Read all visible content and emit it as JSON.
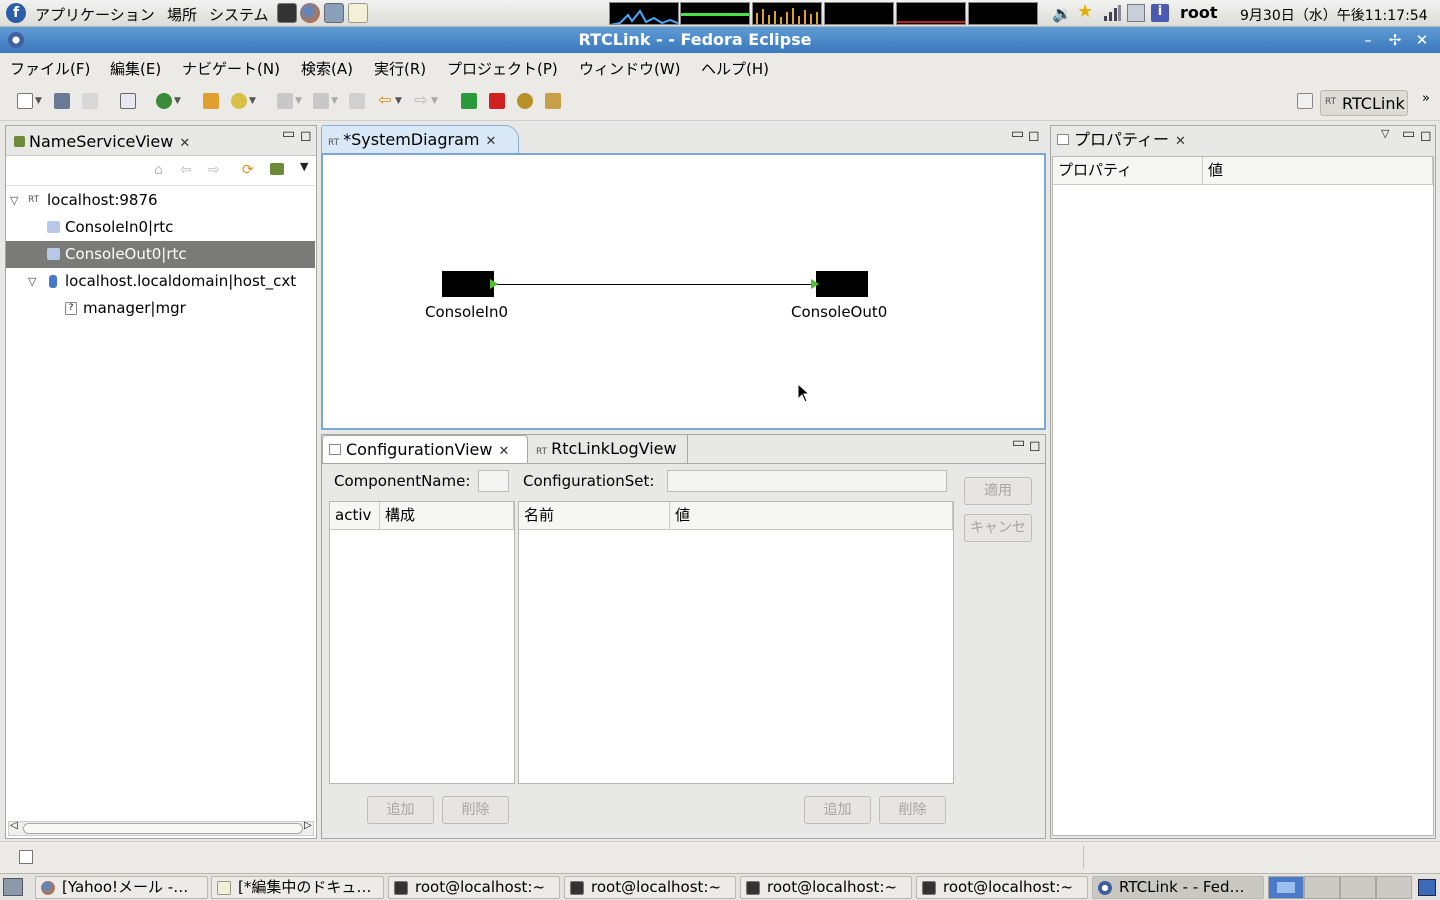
{
  "top_panel": {
    "menus": [
      "アプリケーション",
      "場所",
      "システム"
    ],
    "user": "root",
    "clock": "9月30日（水）午後11:17:54"
  },
  "window": {
    "title": "RTCLink -  - Fedora Eclipse"
  },
  "menubar": [
    "ファイル(F)",
    "編集(E)",
    "ナビゲート(N)",
    "検索(A)",
    "実行(R)",
    "プロジェクト(P)",
    "ウィンドウ(W)",
    "ヘルプ(H)"
  ],
  "perspective": {
    "label": "RTCLink"
  },
  "name_service_view": {
    "tab_label": "NameServiceView",
    "tree": [
      {
        "label": "localhost:9876",
        "expanded": true
      },
      {
        "label": "ConsoleIn0|rtc"
      },
      {
        "label": "ConsoleOut0|rtc",
        "selected": true
      },
      {
        "label": "localhost.localdomain|host_cxt",
        "expanded": true
      },
      {
        "label": "manager|mgr"
      }
    ]
  },
  "system_diagram": {
    "tab_label": "*SystemDiagram",
    "components": [
      {
        "name": "ConsoleIn0"
      },
      {
        "name": "ConsoleOut0"
      }
    ]
  },
  "properties_view": {
    "tab_label": "プロパティー",
    "columns": [
      "プロパティ",
      "値"
    ]
  },
  "configuration_view": {
    "tab_label": "ConfigurationView",
    "second_tab_label": "RtcLinkLogView",
    "component_name_label": "ComponentName:",
    "component_name_value": "",
    "configuration_set_label": "ConfigurationSet:",
    "configuration_set_value": "",
    "left_table_columns": [
      "activ",
      "構成"
    ],
    "right_table_columns": [
      "名前",
      "値"
    ],
    "apply_button": "適用",
    "cancel_button": "キャンセ",
    "left_add_button": "追加",
    "left_delete_button": "削除",
    "right_add_button": "追加",
    "right_delete_button": "削除"
  },
  "taskbar": {
    "tasks": [
      "[Yahoo!メール -…",
      "[*編集中のドキュ…",
      "root@localhost:~",
      "root@localhost:~",
      "root@localhost:~",
      "root@localhost:~",
      "RTCLink -  - Fed…"
    ]
  },
  "colors": {
    "title_bar": "#3b78bd",
    "selection": "#7a7a78",
    "active_tab": "#ffffff",
    "port_green": "#50c030"
  }
}
